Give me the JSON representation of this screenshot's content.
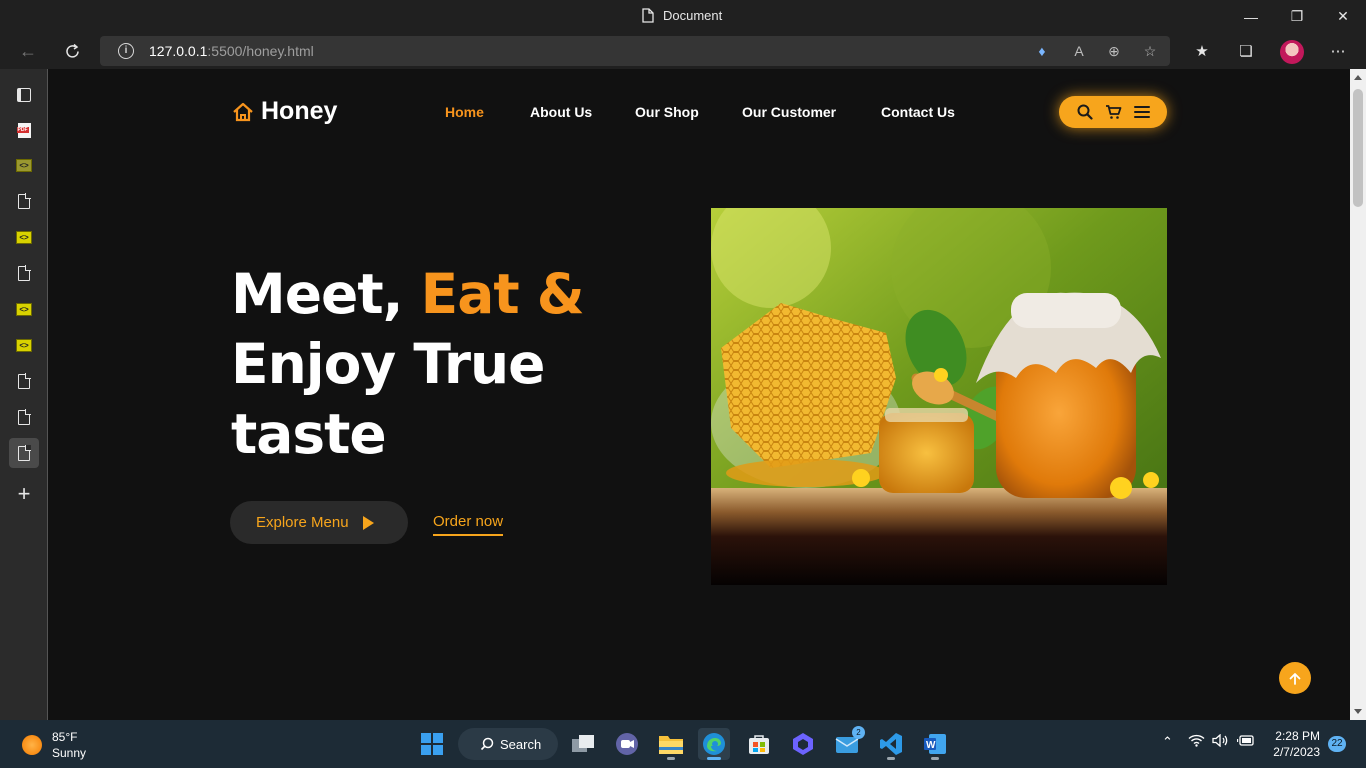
{
  "browser": {
    "tab_title": "Document",
    "url_host": "127.0.0.1",
    "url_rest": ":5500/honey.html"
  },
  "site": {
    "brand": "Honey",
    "nav": [
      "Home",
      "About Us",
      "Our Shop",
      "Our Customer",
      "Contact Us"
    ],
    "active_nav": "Home",
    "hero_line1_white": "Meet, ",
    "hero_line1_accent": "Eat &",
    "hero_line2": "Enjoy True",
    "hero_line3": "taste",
    "explore_label": "Explore Menu",
    "order_label": "Order now",
    "accent_color": "#f7941d"
  },
  "taskbar": {
    "temperature": "85°F",
    "condition": "Sunny",
    "search_label": "Search",
    "mail_badge": "2",
    "time": "2:28 PM",
    "date": "2/7/2023",
    "notifications": "22"
  }
}
